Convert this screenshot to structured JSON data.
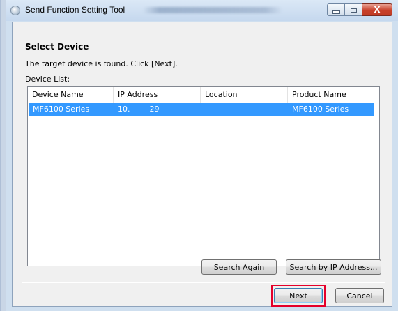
{
  "window": {
    "title": "Send Function Setting Tool",
    "title_blurred_note": "",
    "controls": {
      "minimize": "",
      "maximize": "",
      "close": "X"
    }
  },
  "content": {
    "heading": "Select Device",
    "description": "The target device is found. Click [Next].",
    "device_list_label": "Device List:"
  },
  "device_table": {
    "columns": [
      "Device Name",
      "IP Address",
      "Location",
      "Product Name"
    ],
    "rows": [
      {
        "device_name": "MF6100 Series",
        "ip_address": "10.        29",
        "location": "",
        "product_name": "MF6100 Series",
        "selected": true
      }
    ]
  },
  "buttons": {
    "search_again": "Search Again",
    "search_by_ip": "Search by IP Address...",
    "next": "Next",
    "cancel": "Cancel"
  },
  "colors": {
    "selection": "#3399ff",
    "highlight_box": "#e4002b",
    "close_button": "#c8402a"
  },
  "icons": [
    "app-icon",
    "minimize-icon",
    "maximize-icon",
    "close-icon"
  ]
}
